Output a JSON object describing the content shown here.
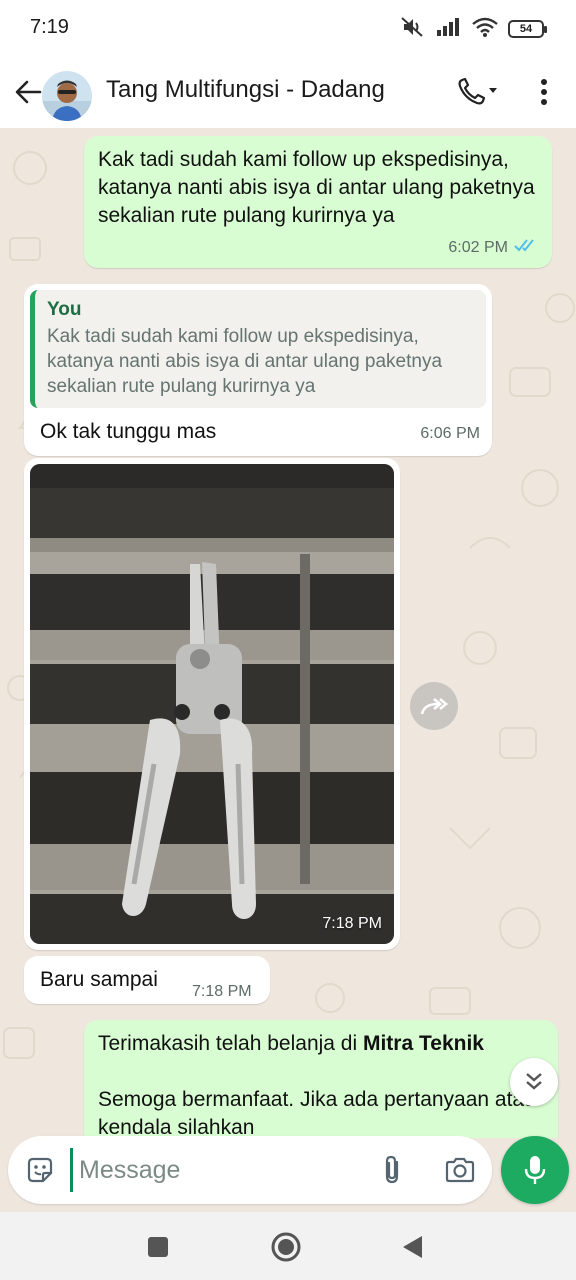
{
  "status_bar": {
    "time": "7:19",
    "battery": "54"
  },
  "header": {
    "contact_name": "Tang Multifungsi - Dadang"
  },
  "messages": [
    {
      "direction": "outgoing",
      "text": "Kak tadi sudah kami follow up ekspedisinya, katanya nanti abis isya di antar ulang paketnya sekalian rute pulang kurirnya ya",
      "time": "6:02 PM",
      "read": true
    },
    {
      "direction": "incoming",
      "quote": {
        "author": "You",
        "text": "Kak tadi sudah kami follow up ekspedisinya, katanya nanti abis isya di antar ulang paketnya sekalian rute pulang kurirnya ya"
      },
      "text": "Ok tak tunggu mas",
      "time": "6:06 PM"
    },
    {
      "direction": "incoming",
      "type": "image",
      "image_subject": "multi-function wire stripper pliers with grey handles on a black bench",
      "time": "7:18 PM"
    },
    {
      "direction": "incoming",
      "text": "Baru sampai",
      "time": "7:18 PM"
    },
    {
      "direction": "outgoing",
      "text_prefix": "Terimakasih telah belanja di ",
      "text_bold": "Mitra Teknik",
      "text_line2": "Semoga bermanfaat. Jika ada pertanyaan atau kendala silahkan"
    }
  ],
  "composer": {
    "placeholder": "Message"
  },
  "colors": {
    "outgoing": "#d9fdd3",
    "incoming": "#ffffff",
    "accent": "#1daa61",
    "chat_bg": "#efe7de",
    "read_ticks": "#53bdeb"
  },
  "icons": [
    "mute-icon",
    "signal-icon",
    "wifi-icon",
    "battery-icon",
    "back-arrow-icon",
    "voice-call-icon",
    "more-vert-icon",
    "forward-icon",
    "scroll-down-icon",
    "sticker-icon",
    "attach-icon",
    "camera-icon",
    "mic-icon",
    "recents-icon",
    "home-icon",
    "back-icon"
  ]
}
